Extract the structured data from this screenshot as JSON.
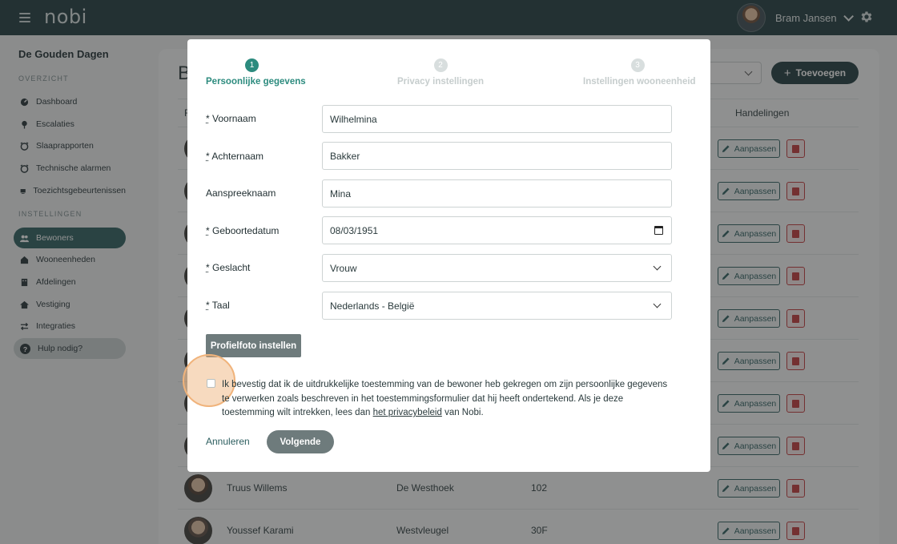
{
  "topbar": {
    "logo": "nobi",
    "user_name": "Bram Jansen",
    "icons": [
      "hamburger-menu-icon",
      "chevron-down-icon",
      "gear-icon"
    ]
  },
  "sidebar": {
    "org_name": "De Gouden Dagen",
    "overview_title": "OVERZICHT",
    "overview_items": [
      {
        "label": "Dashboard",
        "icon": "dashboard-icon"
      },
      {
        "label": "Escalaties",
        "icon": "pin-icon"
      },
      {
        "label": "Slaaprapporten",
        "icon": "alarm-clock-icon"
      },
      {
        "label": "Technische alarmen",
        "icon": "alarm-clock-icon"
      },
      {
        "label": "Toezichtsgebeurtenissen",
        "icon": "monitor-icon"
      }
    ],
    "settings_title": "INSTELLINGEN",
    "settings_items": [
      {
        "label": "Bewoners",
        "icon": "users-icon",
        "active": true
      },
      {
        "label": "Wooneenheden",
        "icon": "home-icon"
      },
      {
        "label": "Afdelingen",
        "icon": "building-icon"
      },
      {
        "label": "Vestiging",
        "icon": "house-icon"
      },
      {
        "label": "Integraties",
        "icon": "arrows-icon"
      }
    ],
    "help_label": "Hulp nodig?"
  },
  "background_page": {
    "title_initial": "B",
    "add_button": "Toevoegen",
    "column_first_initial": "F",
    "column_actions": "Handelingen",
    "edit_label": "Aanpassen",
    "rows": [
      {
        "name": "",
        "unit": "",
        "room": ""
      },
      {
        "name": "",
        "unit": "",
        "room": ""
      },
      {
        "name": "",
        "unit": "",
        "room": ""
      },
      {
        "name": "",
        "unit": "",
        "room": ""
      },
      {
        "name": "",
        "unit": "",
        "room": ""
      },
      {
        "name": "",
        "unit": "",
        "room": ""
      },
      {
        "name": "",
        "unit": "",
        "room": ""
      },
      {
        "name": "",
        "unit": "",
        "room": ""
      },
      {
        "name": "Truus Willems",
        "unit": "De Westhoek",
        "room": "102"
      },
      {
        "name": "Youssef Karami",
        "unit": "Westvleugel",
        "room": "30F"
      }
    ]
  },
  "modal": {
    "steps": [
      {
        "number": "1",
        "label": "Persoonlijke gegevens",
        "active": true
      },
      {
        "number": "2",
        "label": "Privacy instellingen",
        "active": false
      },
      {
        "number": "3",
        "label": "Instellingen wooneenheid",
        "active": false
      }
    ],
    "required_marker": "*",
    "fields": {
      "voornaam": {
        "label": "Voornaam",
        "value": "Wilhelmina",
        "required": true
      },
      "achternaam": {
        "label": "Achternaam",
        "value": "Bakker",
        "required": true
      },
      "aanspreeknaam": {
        "label": "Aanspreeknaam",
        "value": "Mina",
        "required": false
      },
      "geboortedatum": {
        "label": "Geboortedatum",
        "value": "08/03/1951",
        "required": true
      },
      "geslacht": {
        "label": "Geslacht",
        "value": "Vrouw",
        "required": true
      },
      "taal": {
        "label": "Taal",
        "value": "Nederlands - België",
        "required": true
      }
    },
    "photo_button": "Profielfoto instellen",
    "consent_text_before": "Ik bevestig dat ik de uitdrukkelijke toestemming van de bewoner heb gekregen om zijn persoonlijke gegevens te verwerken zoals beschreven in het toestemmingsformulier dat hij heeft ondertekend. Als je deze toestemming wilt intrekken, lees dan ",
    "consent_link": "het privacybeleid",
    "consent_text_after": " van Nobi.",
    "consent_checked": false,
    "cancel_label": "Annuleren",
    "next_label": "Volgende"
  },
  "colors": {
    "topbar": "#1f3b3e",
    "accent": "#2c8b7e",
    "active_nav": "#2c5e5f",
    "danger": "#c0393b",
    "highlight_ring": "#f0b37b"
  }
}
